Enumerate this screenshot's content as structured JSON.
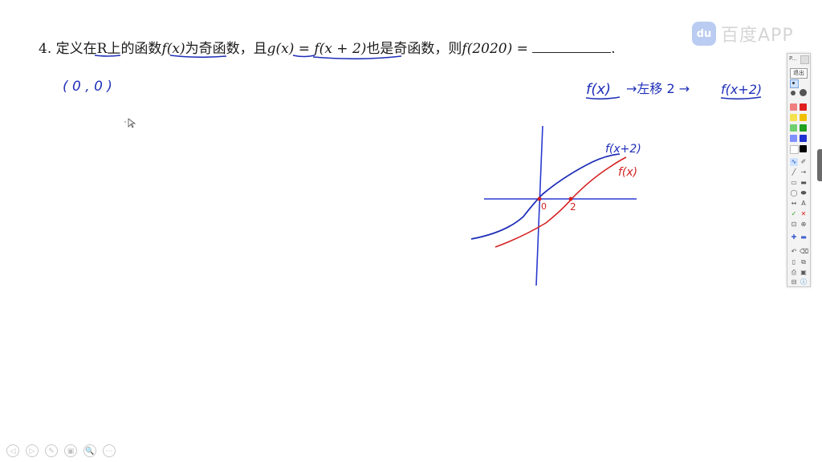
{
  "question": {
    "number": "4. ",
    "t1": "定义在",
    "t2": "R上",
    "t3": "的函数",
    "f_x": "f(x)",
    "t4": "为奇函数，且",
    "g_x": "g(x)",
    "eq": " = ",
    "f_x2": "f(x + 2)",
    "t5": "也是奇函数，则",
    "f_2020": "f(2020)",
    "eq2": " = ",
    "end": "."
  },
  "handwriting": {
    "point": "( 0 , 0 )",
    "shift_f": "f(x)",
    "shift_arrow_text": "→左移 2 →",
    "shift_result": "f(x+2)",
    "curve_blue_label": "f(x+2)",
    "curve_red_label": "f(x)",
    "origin_label": "0",
    "point_label": "2"
  },
  "watermark": {
    "logo": "du",
    "text": "百度APP"
  },
  "toolbar": {
    "title": "P...",
    "exit": "退出",
    "text_tool": "A",
    "check": "✓",
    "cross": "✕",
    "undo": "↶",
    "delete": "🗑",
    "colors": [
      "#f08080",
      "#e02020",
      "#f5e050",
      "#f0c000",
      "#70d070",
      "#20a020",
      "#8090ff",
      "#2030d0",
      "#ffffff",
      "#000000"
    ]
  },
  "colors": {
    "ink_blue": "#1f2fb8",
    "ink_red": "#d42020",
    "axis_blue": "#2a3ad0"
  },
  "bottom_controls": [
    "◁",
    "▷",
    "✎",
    "▣",
    "🔍",
    "⋯"
  ]
}
